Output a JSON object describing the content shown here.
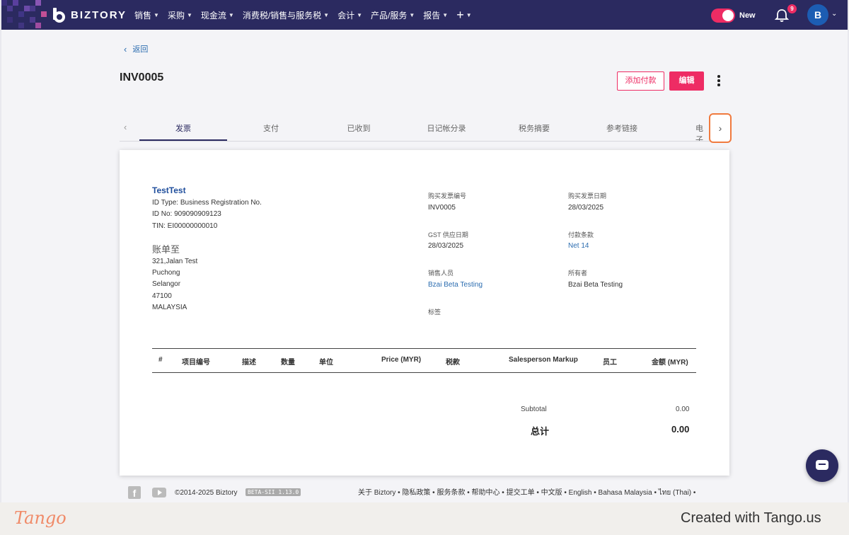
{
  "nav": {
    "brand": "BIZTORY",
    "menu": [
      "销售",
      "采购",
      "现金流",
      "消费税/销售与服务税",
      "会计",
      "产品/服务",
      "报告"
    ],
    "add_symbol": "+",
    "toggle_label": "New",
    "notification_count": "9",
    "avatar_initial": "B"
  },
  "header": {
    "back_label": "返回",
    "title": "INV0005",
    "add_payment_label": "添加付款",
    "edit_label": "编辑"
  },
  "tabs": [
    "发票",
    "支付",
    "已收到",
    "日记帐分录",
    "税务摘要",
    "参考链接",
    "电子"
  ],
  "invoice": {
    "company": "TestTest",
    "id_type": "ID Type: Business Registration No.",
    "id_no": "ID No: 909090909123",
    "tin": "TIN: EI00000000010",
    "bill_to_label": "账单至",
    "address": [
      "321,Jalan Test",
      "Puchong",
      "Selangor",
      "47100",
      "MALAYSIA"
    ],
    "fields": {
      "po_no_label": "购买发票编号",
      "po_no": "INV0005",
      "po_date_label": "购买发票日期",
      "po_date": "28/03/2025",
      "gst_date_label": "GST 供应日期",
      "gst_date": "28/03/2025",
      "terms_label": "付款条款",
      "terms": "Net 14",
      "salesperson_label": "销售人员",
      "salesperson": "Bzai Beta Testing",
      "owner_label": "所有者",
      "owner": "Bzai Beta Testing",
      "tags_label": "标签"
    },
    "columns": [
      "#",
      "项目编号",
      "描述",
      "数量",
      "单位",
      "Price (MYR)",
      "税款",
      "Salesperson Markup",
      "员工",
      "金额 (MYR)"
    ],
    "subtotal_label": "Subtotal",
    "subtotal": "0.00",
    "total_label": "总计",
    "total": "0.00"
  },
  "footer": {
    "copyright": "©2014-2025 Biztory",
    "version": "BETA-SII 1.13.0",
    "links": "关于 Biztory • 隐私政策 • 服务条款 • 帮助中心 • 提交工单 • 中文版 • English • Bahasa Malaysia • ไทย (Thai) •"
  },
  "watermark": {
    "logo": "Tango",
    "text": "Created with Tango.us"
  },
  "colors": {
    "nav_bg": "#2b2a60",
    "accent": "#ee2c64",
    "link": "#2c6db0",
    "highlight": "#f07a3e"
  }
}
